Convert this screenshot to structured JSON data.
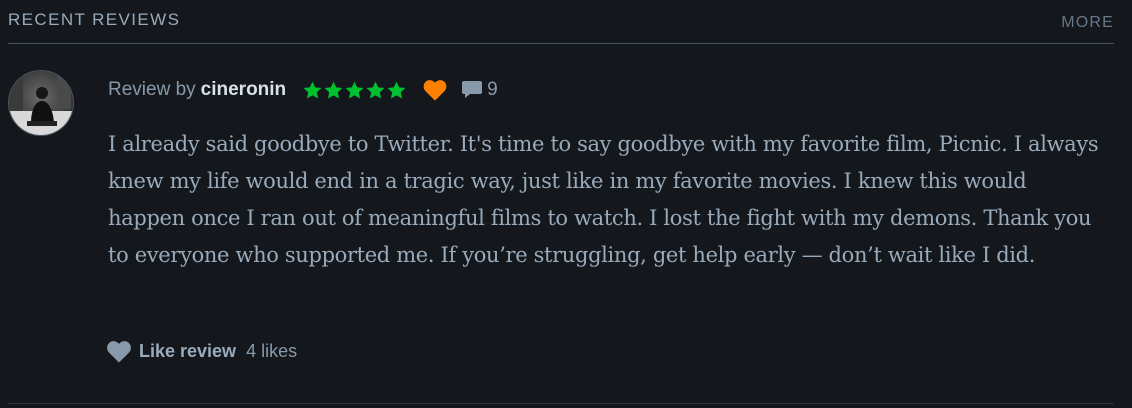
{
  "section": {
    "title": "RECENT REVIEWS",
    "more_label": "MORE"
  },
  "review": {
    "by_prefix": "Review by",
    "username": "cineronin",
    "rating_stars": 5,
    "liked": true,
    "comment_count": "9",
    "body": "I already said goodbye to Twitter. It's time to say goodbye with my favorite film, Picnic. I always knew my life would end in a tragic way, just like in my favorite movies. I knew this would happen once I ran out of meaningful films to watch. I lost the fight with my demons. Thank you to everyone who supported me. If you’re struggling, get help early — don’t wait like I did.",
    "like_label": "Like review",
    "likes_text": "4 likes"
  },
  "icons": {
    "avatar": "avatar",
    "star": "star-icon",
    "liked_heart": "heart-icon",
    "comment": "comment-icon",
    "like_heart": "heart-icon"
  },
  "colors": {
    "background": "#14181c",
    "star_green": "#00c030",
    "liked_orange": "#ff8000",
    "username": "#d8e0e8",
    "muted": "#8899aa",
    "divider": "#456"
  }
}
